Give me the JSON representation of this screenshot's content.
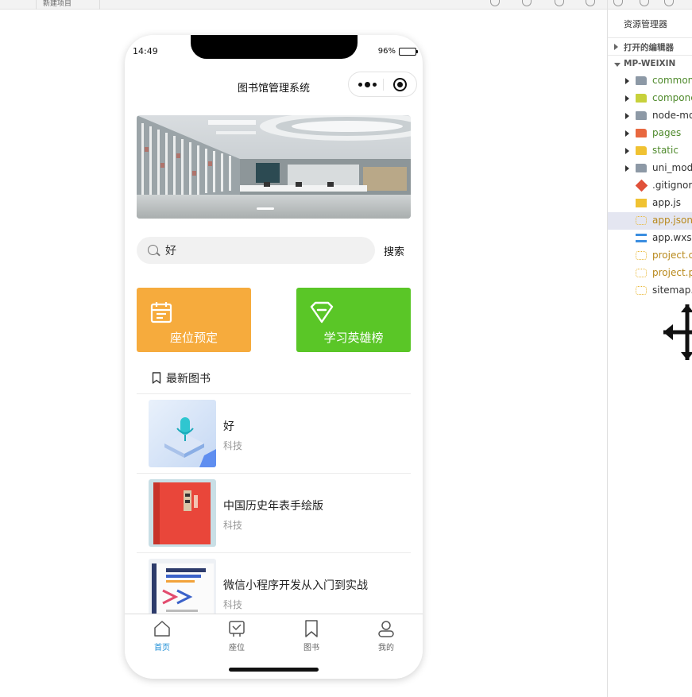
{
  "ide": {
    "tabs": [
      "",
      "新建项目"
    ]
  },
  "status_bar": {
    "time": "14:49",
    "battery": "96%"
  },
  "nav": {
    "title": "图书馆管理系统"
  },
  "search": {
    "value": "好",
    "button": "搜索"
  },
  "quick_cards": [
    {
      "label": "座位预定",
      "icon": "calendar-icon",
      "color": "#f6ab3d"
    },
    {
      "label": "学习英雄榜",
      "icon": "diamond-icon",
      "color": "#5ac627"
    }
  ],
  "section": {
    "title": "最新图书"
  },
  "books": [
    {
      "title": "好",
      "category": "科技"
    },
    {
      "title": "中国历史年表手绘版",
      "category": "科技"
    },
    {
      "title": "微信小程序开发从入门到实战",
      "category": "科技"
    }
  ],
  "tabbar": [
    {
      "label": "首页",
      "icon": "home-icon"
    },
    {
      "label": "座位",
      "icon": "seat-icon"
    },
    {
      "label": "图书",
      "icon": "bookmark-icon"
    },
    {
      "label": "我的",
      "icon": "user-icon"
    }
  ],
  "explorer": {
    "title": "资源管理器",
    "sections": [
      "打开的编辑器",
      "MP-WEIXIN"
    ],
    "items": [
      {
        "name": "common",
        "type": "folder",
        "color": "#8d99a6",
        "text_color": "#4f8a2c"
      },
      {
        "name": "compone",
        "type": "folder",
        "color": "#c7d13b",
        "text_color": "#4f8a2c"
      },
      {
        "name": "node-mo",
        "type": "folder",
        "color": "#8d99a6",
        "text_color": "#333333"
      },
      {
        "name": "pages",
        "type": "folder",
        "color": "#e8683f",
        "text_color": "#4f8a2c"
      },
      {
        "name": "static",
        "type": "folder",
        "color": "#f0c232",
        "text_color": "#4f8a2c"
      },
      {
        "name": "uni_mod",
        "type": "folder",
        "color": "#8d99a6",
        "text_color": "#333333"
      },
      {
        "name": ".gitignore",
        "type": "git",
        "color": "#e0513a",
        "text_color": "#333333"
      },
      {
        "name": "app.js",
        "type": "js",
        "color": "#f0c232",
        "text_color": "#333333"
      },
      {
        "name": "app.json",
        "type": "json",
        "color": "#e8b52e",
        "text_color": "#b8891c"
      },
      {
        "name": "app.wxss",
        "type": "css",
        "color": "#3b8ee0",
        "text_color": "#333333"
      },
      {
        "name": "project.c",
        "type": "json",
        "color": "#e8b52e",
        "text_color": "#b8891c"
      },
      {
        "name": "project.p",
        "type": "json",
        "color": "#e8b52e",
        "text_color": "#b8891c"
      },
      {
        "name": "sitemap.j",
        "type": "json",
        "color": "#e8b52e",
        "text_color": "#333333"
      }
    ]
  }
}
